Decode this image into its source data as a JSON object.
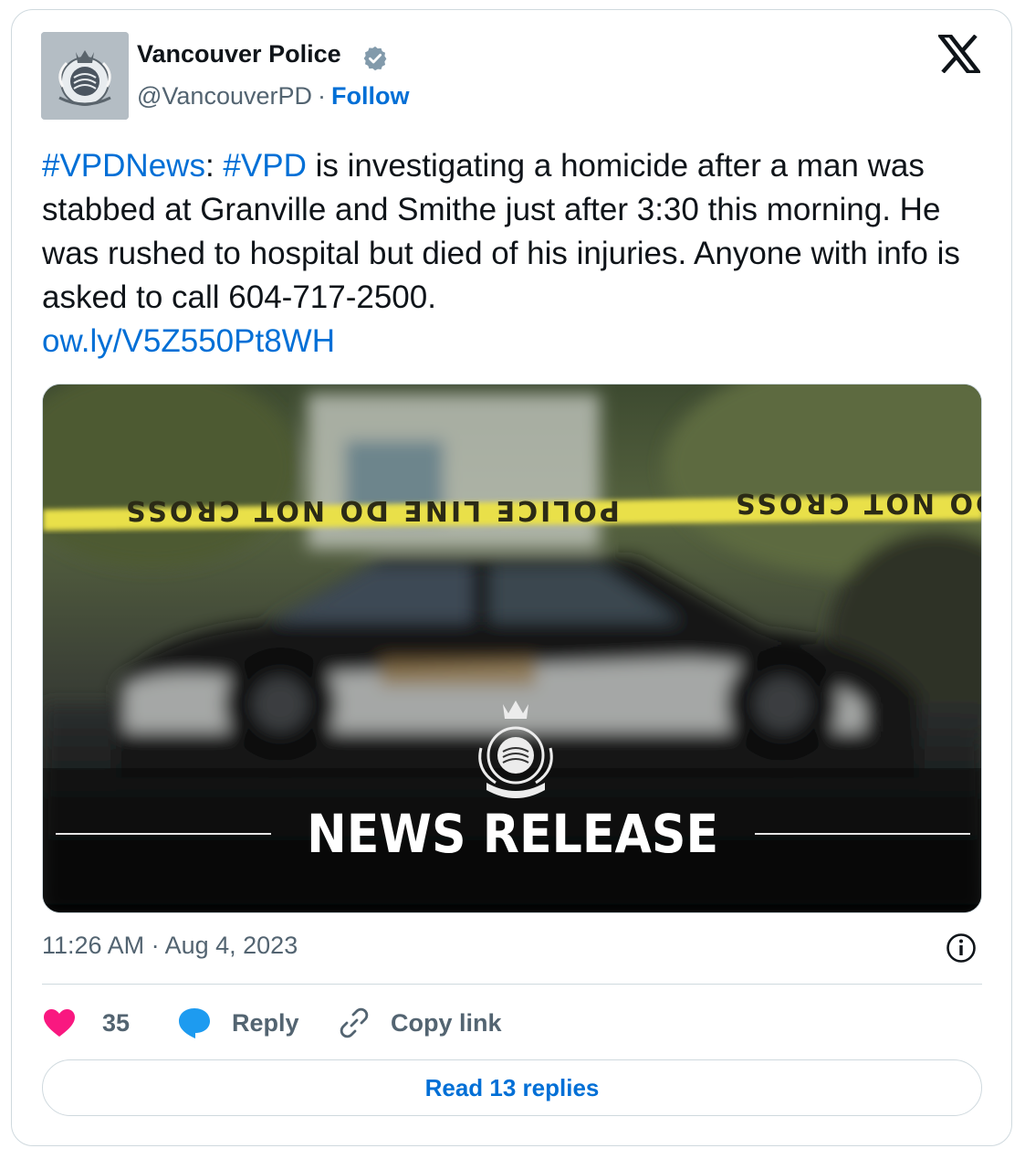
{
  "author": {
    "name": "Vancouver Police",
    "handle": "@VancouverPD",
    "separator": "·",
    "follow_label": "Follow",
    "avatar_icon": "vpd-crest-icon",
    "verified_icon": "verified-badge-icon",
    "verified_color": "#829aab"
  },
  "platform_logo": "x-logo-icon",
  "tweet": {
    "hashtag1": "#VPDNews",
    "colon": ":",
    "hashtag2": "#VPD",
    "body": " is investigating a homicide after a man was stabbed at Granville and Smithe just after 3:30 this morning. He was rushed to hospital but died of his injuries. Anyone with info is asked to call 604-717-2500.",
    "link": "ow.ly/V5Z550Pt8WH"
  },
  "media": {
    "tape_text_left": "POLICE LINE DO NOT CROSS",
    "tape_text_right": "DO NOT CROSS",
    "headline": "NEWS RELEASE",
    "crest_icon": "vpd-crest-icon",
    "tape_color": "#e9e04a"
  },
  "meta": {
    "timestamp": "11:26 AM · Aug 4, 2023",
    "info_icon": "info-icon"
  },
  "actions": {
    "like_count": "35",
    "reply_label": "Reply",
    "copy_label": "Copy link",
    "like_color": "#f91880",
    "reply_color": "#1d9bf0"
  },
  "read_replies": "Read 13 replies",
  "accent_color": "#006fd6"
}
